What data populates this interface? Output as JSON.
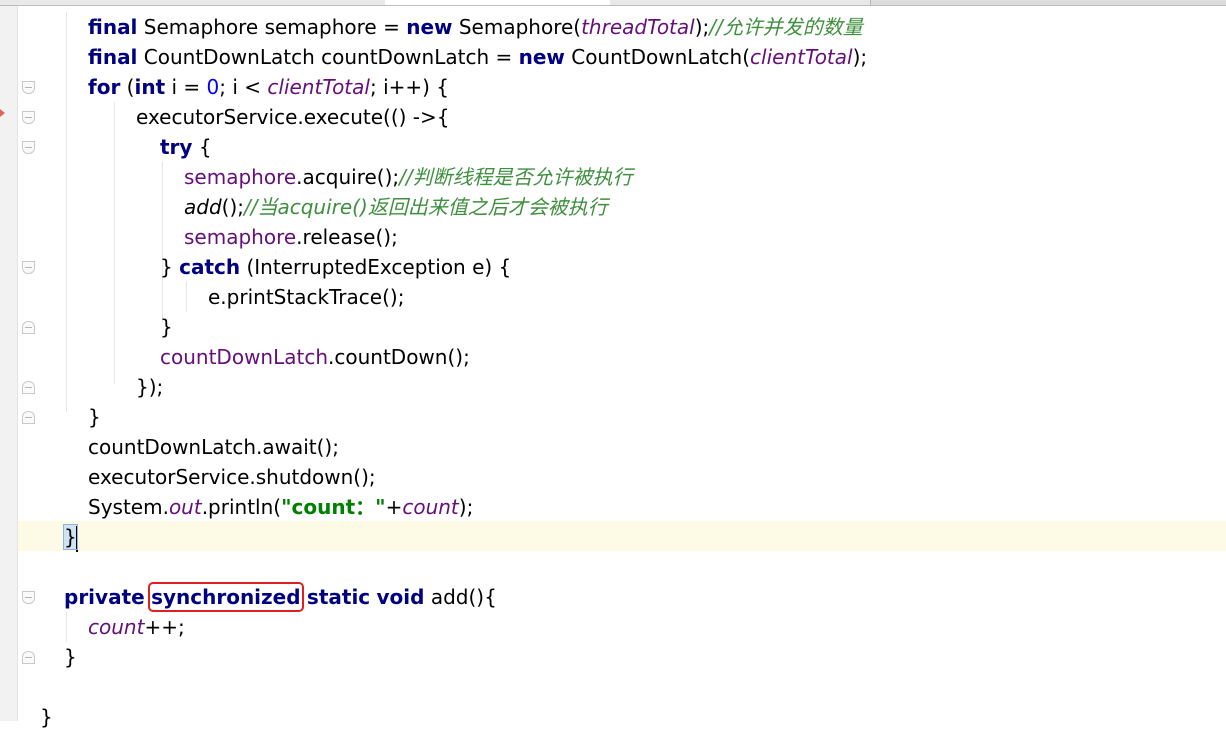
{
  "editor": {
    "lines": [
      {
        "id": "l1",
        "indent": 88,
        "tokens": [
          {
            "t": "final",
            "c": "kw"
          },
          {
            "t": " Semaphore semaphore = "
          },
          {
            "t": "new",
            "c": "kw"
          },
          {
            "t": " Semaphore("
          },
          {
            "t": "threadTotal",
            "c": "st"
          },
          {
            "t": ");"
          },
          {
            "t": "//允许并发的数量",
            "c": "cm"
          }
        ]
      },
      {
        "id": "l2",
        "indent": 88,
        "tokens": [
          {
            "t": "final",
            "c": "kw"
          },
          {
            "t": " CountDownLatch countDownLatch = "
          },
          {
            "t": "new",
            "c": "kw"
          },
          {
            "t": " CountDownLatch("
          },
          {
            "t": "clientTotal",
            "c": "st"
          },
          {
            "t": ");"
          }
        ]
      },
      {
        "id": "l3",
        "indent": 88,
        "tokens": [
          {
            "t": "for",
            "c": "kw"
          },
          {
            "t": " ("
          },
          {
            "t": "int",
            "c": "kw"
          },
          {
            "t": " i = "
          },
          {
            "t": "0",
            "c": "num"
          },
          {
            "t": "; i < "
          },
          {
            "t": "clientTotal",
            "c": "st"
          },
          {
            "t": "; i++) {"
          }
        ]
      },
      {
        "id": "l4",
        "indent": 136,
        "tokens": [
          {
            "t": "executorService.execute(() ->{"
          }
        ]
      },
      {
        "id": "l5",
        "indent": 160,
        "tokens": [
          {
            "t": "try",
            "c": "kw"
          },
          {
            "t": " {"
          }
        ]
      },
      {
        "id": "l6",
        "indent": 184,
        "tokens": [
          {
            "t": "semaphore",
            "c": "fld"
          },
          {
            "t": ".acquire();"
          },
          {
            "t": "//判断线程是否允许被执行",
            "c": "cm"
          }
        ]
      },
      {
        "id": "l7",
        "indent": 184,
        "tokens": [
          {
            "t": "add",
            "c": "stm"
          },
          {
            "t": "();"
          },
          {
            "t": "//当acquire()返回出来值之后才会被执行",
            "c": "cm"
          }
        ]
      },
      {
        "id": "l8",
        "indent": 184,
        "tokens": [
          {
            "t": "semaphore",
            "c": "fld"
          },
          {
            "t": ".release();"
          }
        ]
      },
      {
        "id": "l9",
        "indent": 160,
        "tokens": [
          {
            "t": "} "
          },
          {
            "t": "catch",
            "c": "kw"
          },
          {
            "t": " (InterruptedException e) {"
          }
        ]
      },
      {
        "id": "l10",
        "indent": 208,
        "tokens": [
          {
            "t": "e.printStackTrace();"
          }
        ]
      },
      {
        "id": "l11",
        "indent": 160,
        "tokens": [
          {
            "t": "}"
          }
        ]
      },
      {
        "id": "l12",
        "indent": 160,
        "tokens": [
          {
            "t": "countDownLatch",
            "c": "fld"
          },
          {
            "t": ".countDown();"
          }
        ]
      },
      {
        "id": "l13",
        "indent": 136,
        "tokens": [
          {
            "t": "});"
          }
        ]
      },
      {
        "id": "l14",
        "indent": 88,
        "tokens": [
          {
            "t": "}"
          }
        ]
      },
      {
        "id": "l15",
        "indent": 88,
        "tokens": [
          {
            "t": "countDownLatch.await();"
          }
        ]
      },
      {
        "id": "l16",
        "indent": 88,
        "tokens": [
          {
            "t": "executorService.shutdown();"
          }
        ]
      },
      {
        "id": "l17",
        "indent": 88,
        "tokens": [
          {
            "t": "System."
          },
          {
            "t": "out",
            "c": "st"
          },
          {
            "t": ".println("
          },
          {
            "t": "\"count：\"",
            "c": "strg"
          },
          {
            "t": "+"
          },
          {
            "t": "count",
            "c": "st"
          },
          {
            "t": ");"
          }
        ]
      },
      {
        "id": "l18",
        "indent": 64,
        "tokens": [
          {
            "t": "}",
            "c": "brace-hl"
          }
        ]
      },
      {
        "id": "l19",
        "indent": 0,
        "tokens": []
      },
      {
        "id": "l20",
        "indent": 64,
        "tokens": [
          {
            "t": "private",
            "c": "kw"
          },
          {
            "t": " "
          },
          {
            "t": "synchronized",
            "c": "kw hl-box"
          },
          {
            "t": " "
          },
          {
            "t": "static",
            "c": "kw"
          },
          {
            "t": " "
          },
          {
            "t": "void",
            "c": "kw"
          },
          {
            "t": " add(){"
          }
        ]
      },
      {
        "id": "l21",
        "indent": 88,
        "tokens": [
          {
            "t": "count",
            "c": "st"
          },
          {
            "t": "++;"
          }
        ]
      },
      {
        "id": "l22",
        "indent": 64,
        "tokens": [
          {
            "t": "}"
          }
        ]
      },
      {
        "id": "l23",
        "indent": 0,
        "tokens": []
      },
      {
        "id": "l24",
        "indent": 40,
        "tokens": [
          {
            "t": "}"
          }
        ]
      }
    ]
  }
}
